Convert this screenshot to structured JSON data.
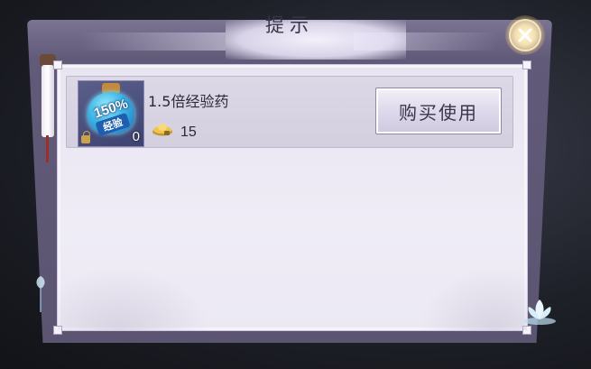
{
  "dialog": {
    "title": "提示"
  },
  "item": {
    "name": "1.5倍经验药",
    "icon_text": "150%",
    "icon_sub": "经验",
    "owned_quantity": "0",
    "price": "15",
    "currency_icon": "gold-ingot-icon"
  },
  "buttons": {
    "buy_use": "购买使用",
    "close_icon": "close-icon"
  },
  "colors": {
    "frame": "#615a78",
    "panel": "#ebe8f3",
    "button_text": "#3a3446"
  }
}
